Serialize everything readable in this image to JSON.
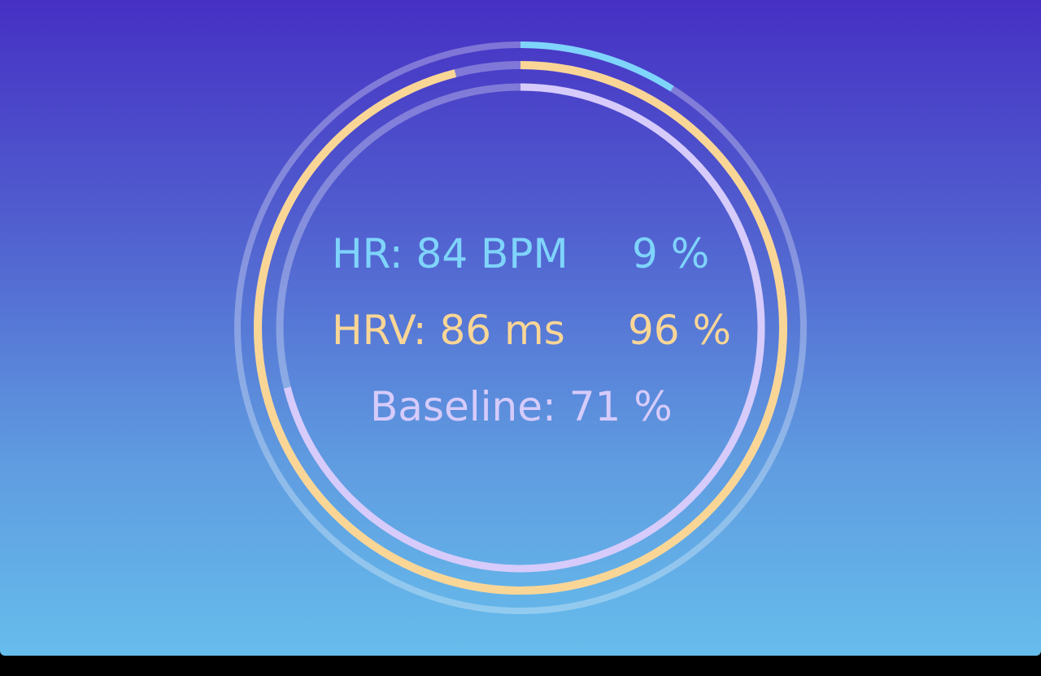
{
  "colors": {
    "hr": "#7fd4fb",
    "hrv": "#fad696",
    "baseline": "#d6cbfb",
    "track": "#ffffff"
  },
  "metrics": {
    "hr": {
      "label": "HR: 84 BPM",
      "percent_text": "9 %",
      "percent": 9
    },
    "hrv": {
      "label": "HRV: 86 ms",
      "percent_text": "96 %",
      "percent": 96
    },
    "baseline": {
      "label": "Baseline: 71 %",
      "percent": 71
    }
  }
}
